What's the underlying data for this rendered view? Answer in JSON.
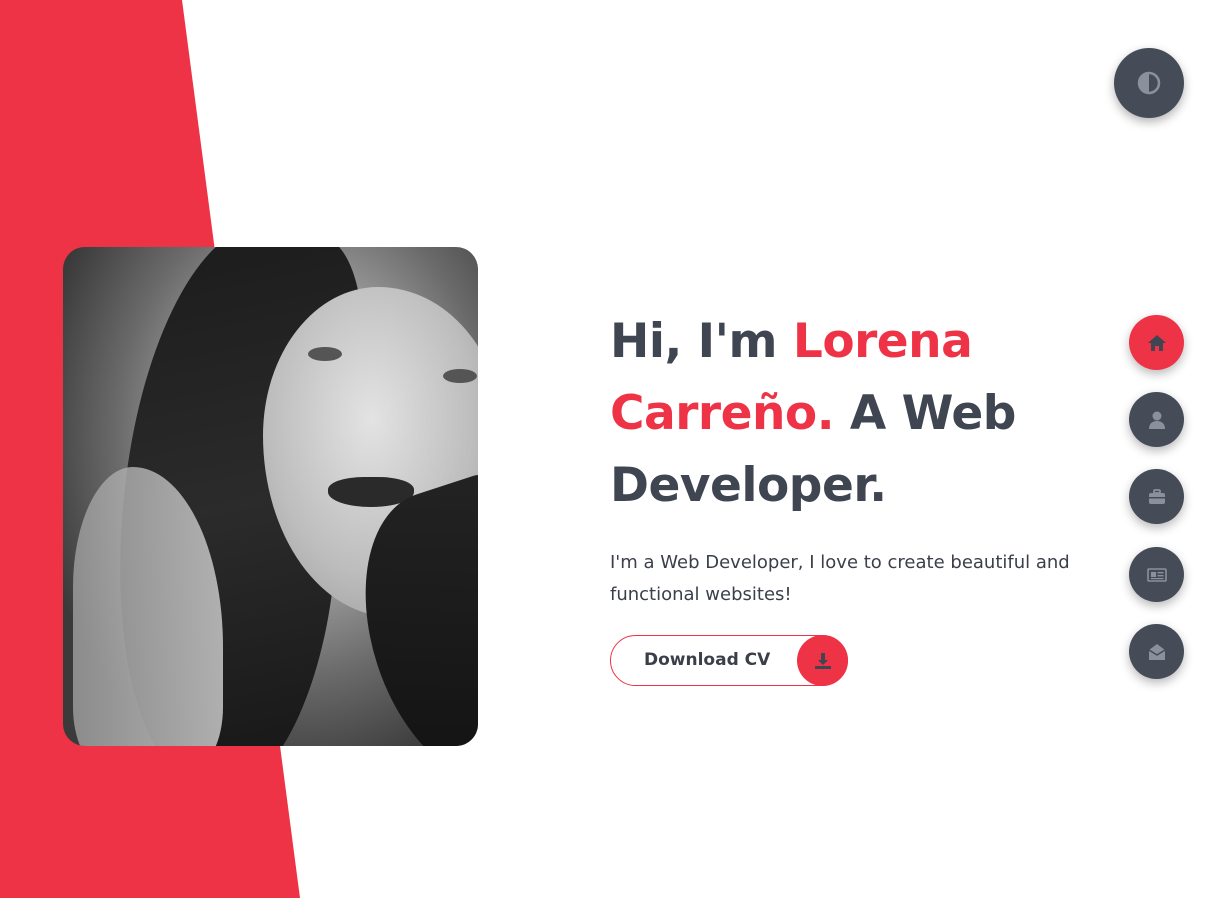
{
  "hero": {
    "title_part1": "Hi, I'm ",
    "title_name": "Lorena Carreño.",
    "title_part2": " A Web Developer.",
    "description": "I'm a Web Developer, I love to create beautiful and functional websites!",
    "cv_button_label": "Download CV"
  },
  "photo": {
    "alt": "Lorena Carreño"
  },
  "theme_toggle": {
    "icon": "contrast-icon"
  },
  "nav": {
    "items": [
      {
        "icon": "home-icon",
        "active": true
      },
      {
        "icon": "user-icon",
        "active": false
      },
      {
        "icon": "briefcase-icon",
        "active": false
      },
      {
        "icon": "newspaper-icon",
        "active": false
      },
      {
        "icon": "envelope-open-icon",
        "active": false
      }
    ]
  },
  "colors": {
    "accent": "#ee3346",
    "dark": "#3f4551",
    "button_bg": "#454c58",
    "icon_muted": "#8b919b"
  }
}
